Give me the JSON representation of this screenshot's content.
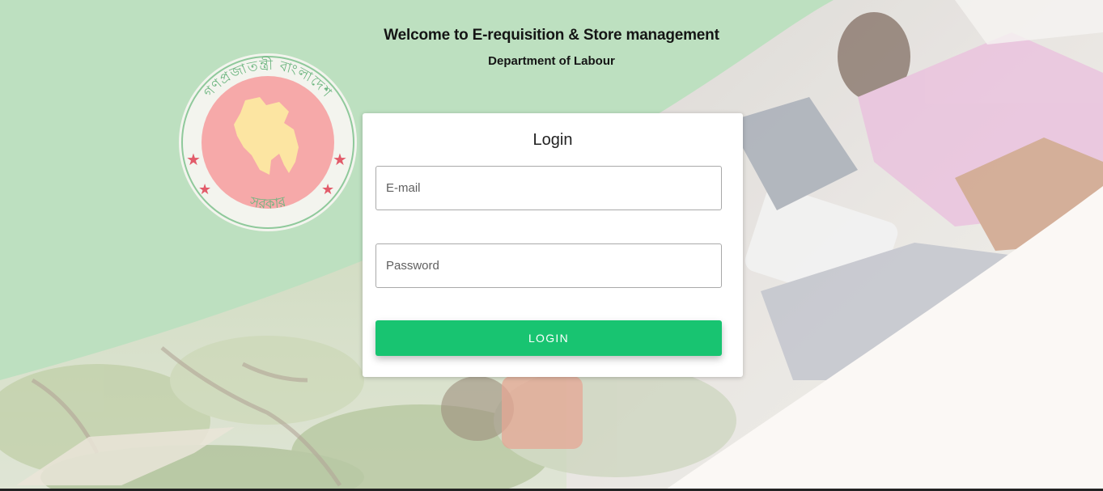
{
  "header": {
    "title": "Welcome to E-requisition & Store management",
    "subtitle": "Department of Labour"
  },
  "logo": {
    "name": "bangladesh-government-seal",
    "top_text": "গণপ্রজাতন্ত্রী বাংলাদেশ",
    "bottom_text": "সরকার"
  },
  "login": {
    "title": "Login",
    "email_placeholder": "E-mail",
    "password_placeholder": "Password",
    "button_label": "LOGIN"
  },
  "colors": {
    "green_band": "#b4dcb8",
    "button": "#18c471",
    "seal_red": "#f5a9a9",
    "seal_map": "#fbe6a2"
  }
}
